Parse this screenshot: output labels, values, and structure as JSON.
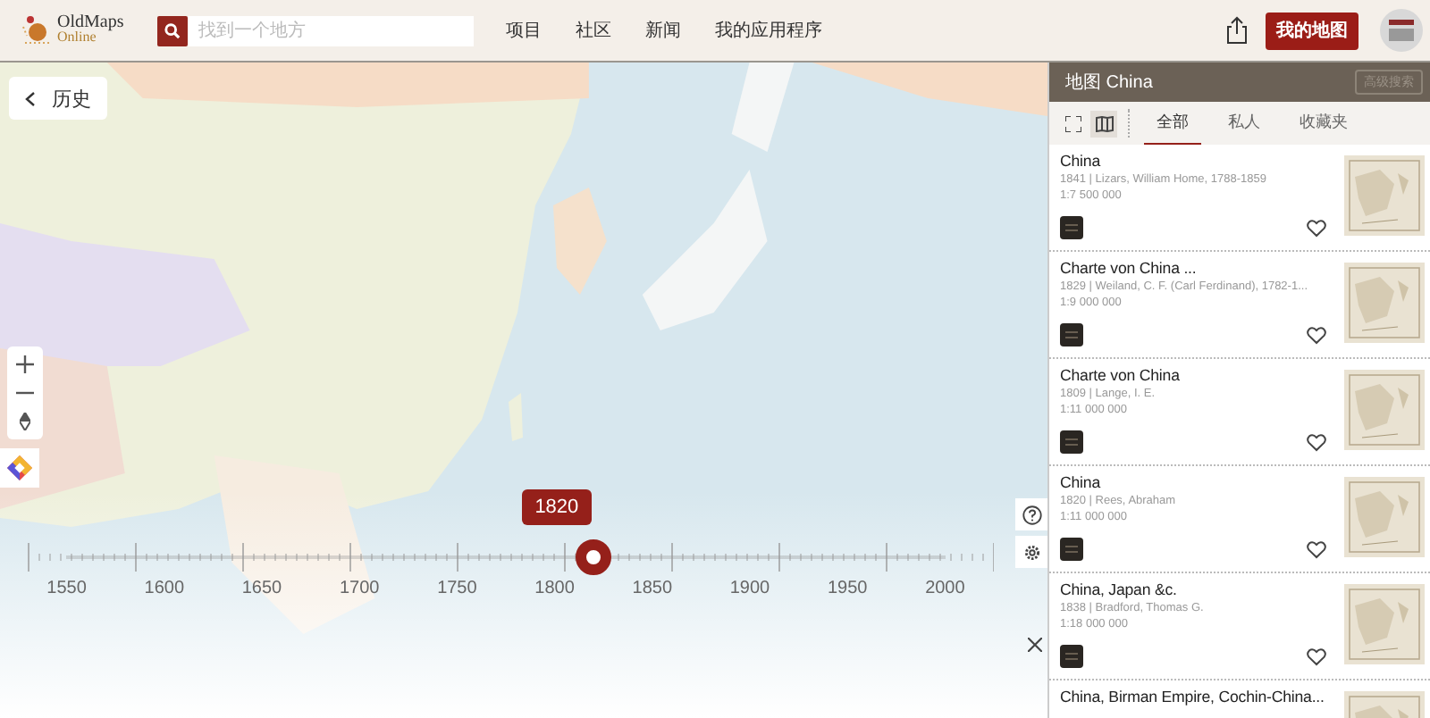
{
  "header": {
    "logo": {
      "title": "OldMaps",
      "subtitle": "Online"
    },
    "search": {
      "placeholder": "找到一个地方"
    },
    "nav": [
      "项目",
      "社区",
      "新闻",
      "我的应用程序"
    ],
    "my_maps_button": "我的地图"
  },
  "map": {
    "back_button": "历史",
    "timeline": {
      "years": [
        "1550",
        "1600",
        "1650",
        "1700",
        "1750",
        "1800",
        "1850",
        "1900",
        "1950",
        "2000"
      ],
      "level": 0.6,
      "current": "1820"
    }
  },
  "panel": {
    "title": "地图 China",
    "advanced_button": "高级搜索",
    "view_toggles": [
      {
        "kind": "grid",
        "selected": false
      },
      {
        "kind": "map",
        "selected": true
      }
    ],
    "tabs": [
      {
        "label": "全部",
        "selected": true
      },
      {
        "label": "私人",
        "selected": false
      },
      {
        "label": "收藏夹",
        "selected": false
      }
    ],
    "results": [
      {
        "title": "China",
        "details": "1841 | Lizars, William Home, 1788-1859",
        "scale": "1:7 500 000"
      },
      {
        "title": "Charte von China ...",
        "details": "1829 | Weiland, C. F. (Carl Ferdinand), 1782-1...",
        "scale": "1:9 000 000"
      },
      {
        "title": "Charte von China",
        "details": "1809 | Lange, I. E.",
        "scale": "1:11 000 000"
      },
      {
        "title": "China",
        "details": "1820 | Rees, Abraham",
        "scale": "1:11 000 000"
      },
      {
        "title": "China, Japan &c.",
        "details": "1838 | Bradford, Thomas G.",
        "scale": "1:18 000 000"
      },
      {
        "title": "China, Birman Empire, Cochin-China..."
      }
    ]
  }
}
